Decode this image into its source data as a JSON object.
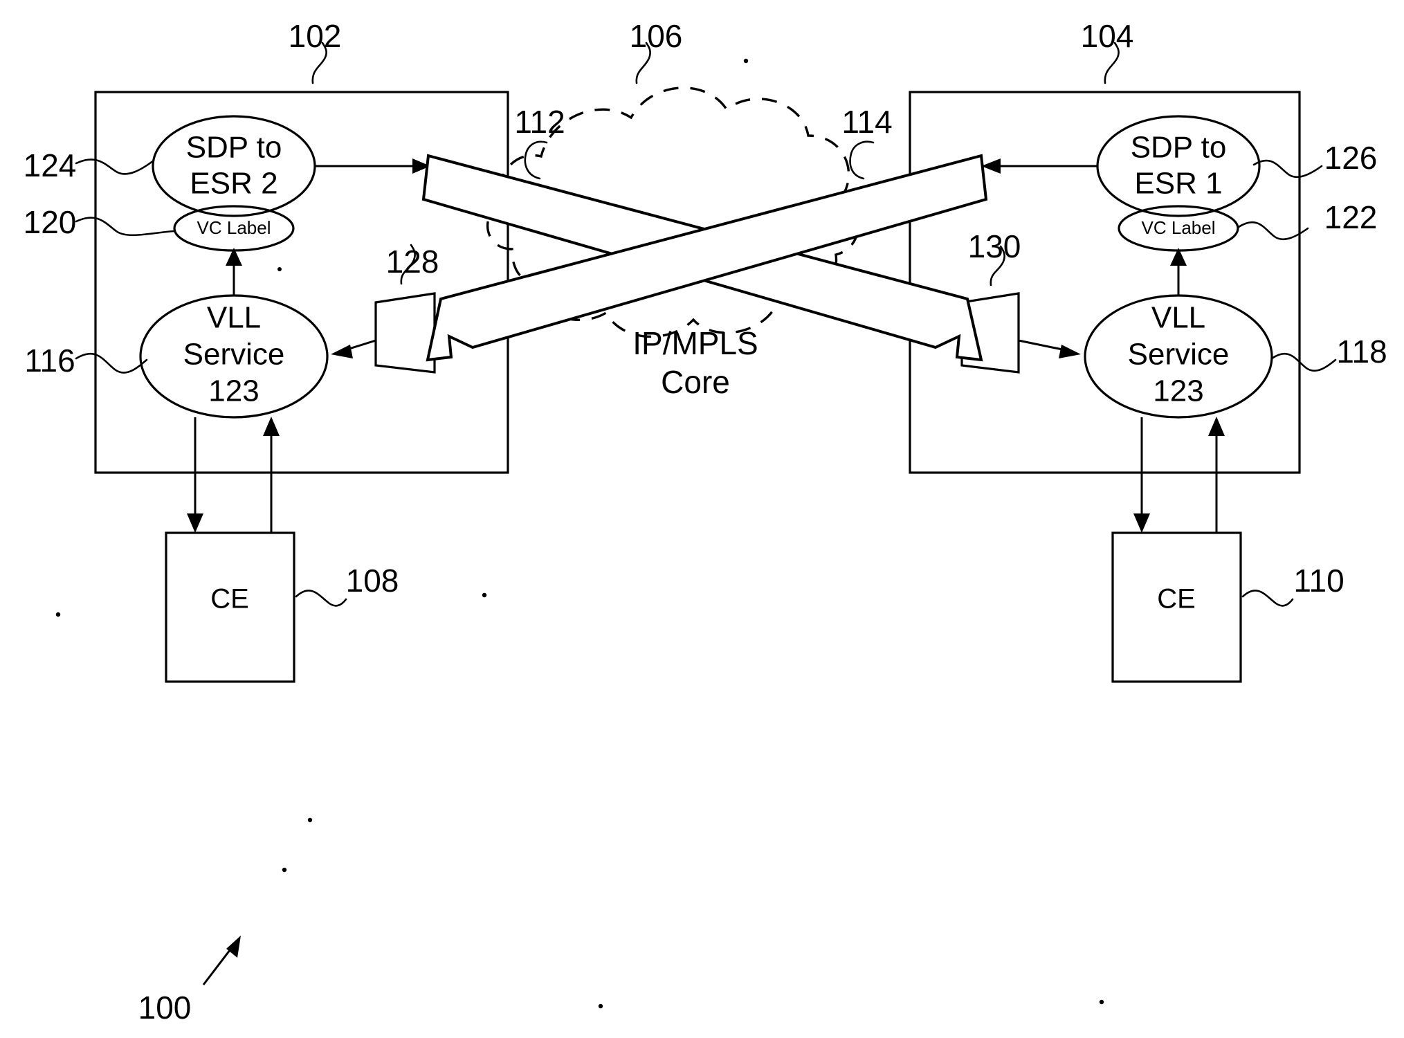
{
  "figure": {
    "figure_ref": "100",
    "left_box": {
      "ref": "102",
      "sdp": {
        "line1": "SDP to",
        "line2": "ESR 2",
        "ref": "124"
      },
      "vc_label": {
        "text": "VC Label",
        "ref": "120"
      },
      "vll": {
        "line1": "VLL",
        "line2": "Service",
        "line3": "123",
        "ref": "116"
      },
      "funnel_ref": "128",
      "tunnel_ref": "112"
    },
    "right_box": {
      "ref": "104",
      "sdp": {
        "line1": "SDP to",
        "line2": "ESR 1",
        "ref": "126"
      },
      "vc_label": {
        "text": "VC Label",
        "ref": "122"
      },
      "vll": {
        "line1": "VLL",
        "line2": "Service",
        "line3": "123",
        "ref": "118"
      },
      "funnel_ref": "130",
      "tunnel_ref": "114"
    },
    "core": {
      "line1": "IP/MPLS",
      "line2": "Core",
      "ref": "106"
    },
    "ce_left": {
      "label": "CE",
      "ref": "108"
    },
    "ce_right": {
      "label": "CE",
      "ref": "110"
    },
    "colors": {
      "ink": "#000000",
      "paper": "#ffffff"
    }
  }
}
